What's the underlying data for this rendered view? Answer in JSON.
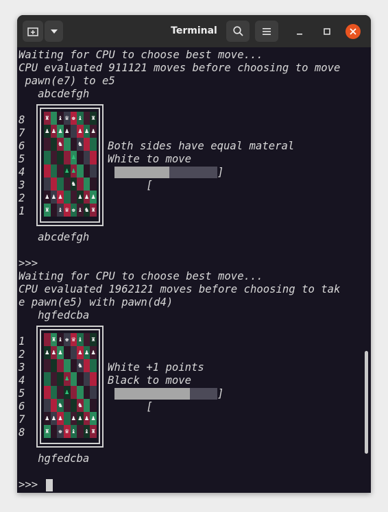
{
  "window": {
    "title": "Terminal",
    "buttons": [
      "new-tab",
      "tab-menu",
      "search",
      "menu",
      "minimize",
      "maximize",
      "close"
    ],
    "colors": {
      "close": "#e95420",
      "background": "#171421"
    }
  },
  "terminal": {
    "lines": [
      "Waiting for CPU to choose best move...",
      "CPU evaluated 911121 moves before choosing to move",
      " pawn(e7) to e5",
      "   abcdefgh",
      "   abcdefgh",
      ">>>",
      "Waiting for CPU to choose best move...",
      "CPU evaluated 1962121 moves before choosing to tak",
      "e pawn(e5) with pawn(d4)",
      "   hgfedcba",
      "   hgfedcba",
      ">>> "
    ],
    "board1": {
      "ranks": [
        "8",
        "7",
        "6",
        "5",
        "4",
        "3",
        "2",
        "1"
      ],
      "rows": [
        [
          "♜",
          "",
          "♝",
          "♛",
          "♚",
          "♝",
          "",
          "♜"
        ],
        [
          "♟",
          "♟",
          "♟",
          "♟",
          "",
          "♟",
          "♟",
          "♟"
        ],
        [
          "",
          "",
          "♞",
          "",
          "",
          "♞",
          "",
          ""
        ],
        [
          "",
          "",
          "",
          "",
          "♟",
          "",
          "",
          ""
        ],
        [
          "",
          "",
          "",
          "♟",
          "♟",
          "",
          "",
          ""
        ],
        [
          "",
          "",
          "",
          "",
          "♞",
          "",
          "",
          ""
        ],
        [
          "♟",
          "♟",
          "♟",
          "",
          "",
          "♟",
          "♟",
          "♟"
        ],
        [
          "♜",
          "",
          "♝",
          "♛",
          "♚",
          "♝",
          "♞",
          "♜"
        ]
      ],
      "status_line1": "Both sides have equal materal",
      "status_line2": "White to move",
      "progress": 0.53
    },
    "board2": {
      "ranks": [
        "1",
        "2",
        "3",
        "4",
        "5",
        "6",
        "7",
        "8"
      ],
      "rows": [
        [
          "",
          "♜",
          "♝",
          "♚",
          "♛",
          "♝",
          "",
          "♜"
        ],
        [
          "♟",
          "♟",
          "♟",
          "",
          "",
          "♟",
          "♟",
          "♟"
        ],
        [
          "",
          "",
          "",
          "",
          "",
          "♞",
          "",
          ""
        ],
        [
          "",
          "",
          "",
          "♟",
          "",
          "",
          "",
          ""
        ],
        [
          "",
          "",
          "",
          "♟",
          "",
          "",
          "",
          ""
        ],
        [
          "",
          "",
          "♞",
          "",
          "",
          "♞",
          "",
          ""
        ],
        [
          "♟",
          "♟",
          "♟",
          "",
          "♟",
          "♟",
          "♟",
          "♟"
        ],
        [
          "♜",
          "",
          "♚",
          "♛",
          "♝",
          "",
          "♝",
          "♜"
        ]
      ],
      "status_line1": "White +1 points",
      "status_line2": "Black to move",
      "progress": 0.73
    }
  }
}
